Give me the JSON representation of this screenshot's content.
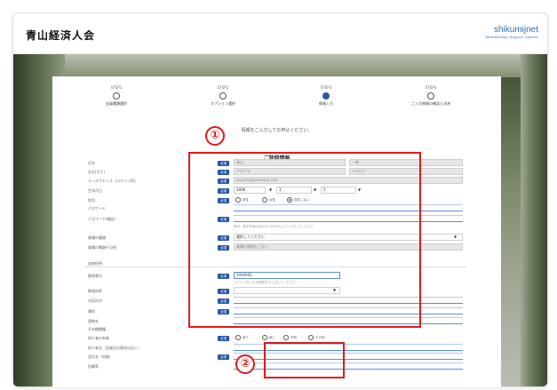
{
  "header": {
    "site_title": "青山経済人会",
    "logo_main": "shikumijnet",
    "logo_sub": "Membership Support System"
  },
  "steps": [
    {
      "label": "STEP1",
      "name": "会員種類選択",
      "active": false
    },
    {
      "label": "STEP2",
      "name": "オプション選択",
      "active": false
    },
    {
      "label": "STEP3",
      "name": "情報入力",
      "active": true
    },
    {
      "label": "STEP4",
      "name": "ご入力情報の確認と決済",
      "active": false
    }
  ],
  "intro": "情報をご入力してお申込ください。",
  "section_title": "ご登録情報",
  "required_label": "必須",
  "fields": {
    "name": {
      "label": "氏名",
      "last_placeholder": "青山",
      "first_placeholder": "一郎"
    },
    "kana": {
      "label": "氏名(カナ)",
      "last_placeholder": "アオヤマ",
      "first_placeholder": "イチロウ"
    },
    "email": {
      "label": "メールアドレス（ログインID）",
      "placeholder": "aoyama@example.com"
    },
    "birthday": {
      "label": "生年月日",
      "year": "2000",
      "month": "1",
      "day": "1"
    },
    "gender": {
      "label": "性別",
      "options": [
        "男性",
        "女性",
        "回答しない"
      ],
      "selected": 2
    },
    "password": {
      "label": "パスワード"
    },
    "password_confirm": {
      "label": "パスワード(確認)",
      "hint": "英字、数字を組み合わせて8文字以上で入力してください。"
    },
    "industry": {
      "label": "業種の種類",
      "value": "選択してください"
    },
    "industry_other": {
      "label": "業種の種類その他",
      "placeholder": "業種の種類をご記入"
    }
  },
  "address_group": "自宅住所",
  "address_fields": {
    "postal": {
      "label": "郵便番号",
      "value": "1000001",
      "hint": "ハイフンなしの半角数字で入力してください"
    },
    "prefecture": {
      "label": "都道府県"
    },
    "city": {
      "label": "市区町村"
    },
    "street": {
      "label": "番地"
    },
    "building": {
      "label": "建物名"
    }
  },
  "other_group": "その他情報",
  "other_fields": {
    "referral_check": {
      "label": "紹介者の有無",
      "options": [
        "有り",
        "無し",
        "不明",
        "その他"
      ]
    },
    "referral_name": {
      "label": "紹介者名（会員名の場合は記入）"
    },
    "company": {
      "label": "会社名（所属）"
    },
    "title": {
      "label": "役職等"
    }
  },
  "callouts": [
    "①",
    "②"
  ],
  "colors": {
    "accent": "#2456a6",
    "callout": "#e01a1a",
    "brand": "#1aa34a"
  }
}
